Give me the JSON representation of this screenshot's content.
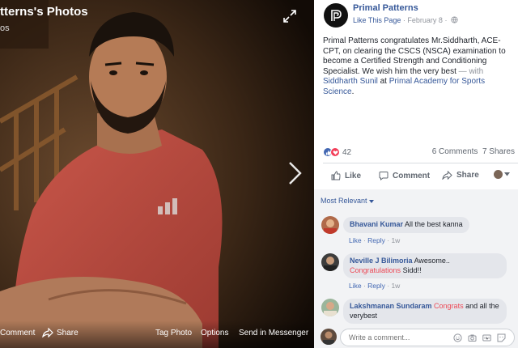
{
  "viewer": {
    "title": "tterns's Photos",
    "subtitle": "os",
    "bottom_bar": {
      "comment_label": "Comment",
      "share_label": "Share",
      "tag_photo_label": "Tag Photo",
      "options_label": "Options",
      "send_label": "Send in Messenger"
    }
  },
  "post": {
    "page_name": "Primal Patterns",
    "like_page_label": "Like This Page",
    "separator": "·",
    "date": "February 8",
    "text_main": "Primal Patterns congratulates Mr.Siddharth, ACE-CPT, on clearing the CSCS (NSCA) examination to become a Certified Strength and Conditioning Specialist. We wish him the very best",
    "text_with": " — with ",
    "tagged_person": "Siddharth Sunil",
    "text_at": " at ",
    "tagged_place": "Primal Academy for Sports Science",
    "text_end": "."
  },
  "stats": {
    "reaction_count": "42",
    "comments_count": "6 Comments",
    "shares_count": "7 Shares"
  },
  "actions": {
    "like_label": "Like",
    "comment_label": "Comment",
    "share_label": "Share"
  },
  "comments": {
    "sort_label": "Most Relevant",
    "items": [
      {
        "author": "Bhavani Kumar",
        "text": "All the best kanna",
        "like_label": "Like",
        "reply_label": "Reply",
        "time": "1w"
      },
      {
        "author": "Neville J Bilimoria",
        "text_before": "Awesome..",
        "highlight": "Congratulations",
        "text_after": "Sidd!!",
        "like_label": "Like",
        "reply_label": "Reply",
        "time": "1w"
      },
      {
        "author": "Lakshmanan Sundaram",
        "highlight": "Congrats",
        "text_after": "and all the verybest"
      }
    ],
    "composer_placeholder": "Write a comment..."
  },
  "colors": {
    "link": "#365899",
    "congrats": "#ed4956",
    "like_blue": "#4267b2",
    "love_red": "#f33e58"
  },
  "icons": [
    "expand-icon",
    "next-arrow-icon",
    "share-icon",
    "globe-icon",
    "like-icon",
    "love-icon",
    "thumbs-up-icon",
    "comment-icon",
    "caret-down-icon",
    "emoji-icon",
    "camera-icon",
    "gif-icon",
    "sticker-icon"
  ]
}
